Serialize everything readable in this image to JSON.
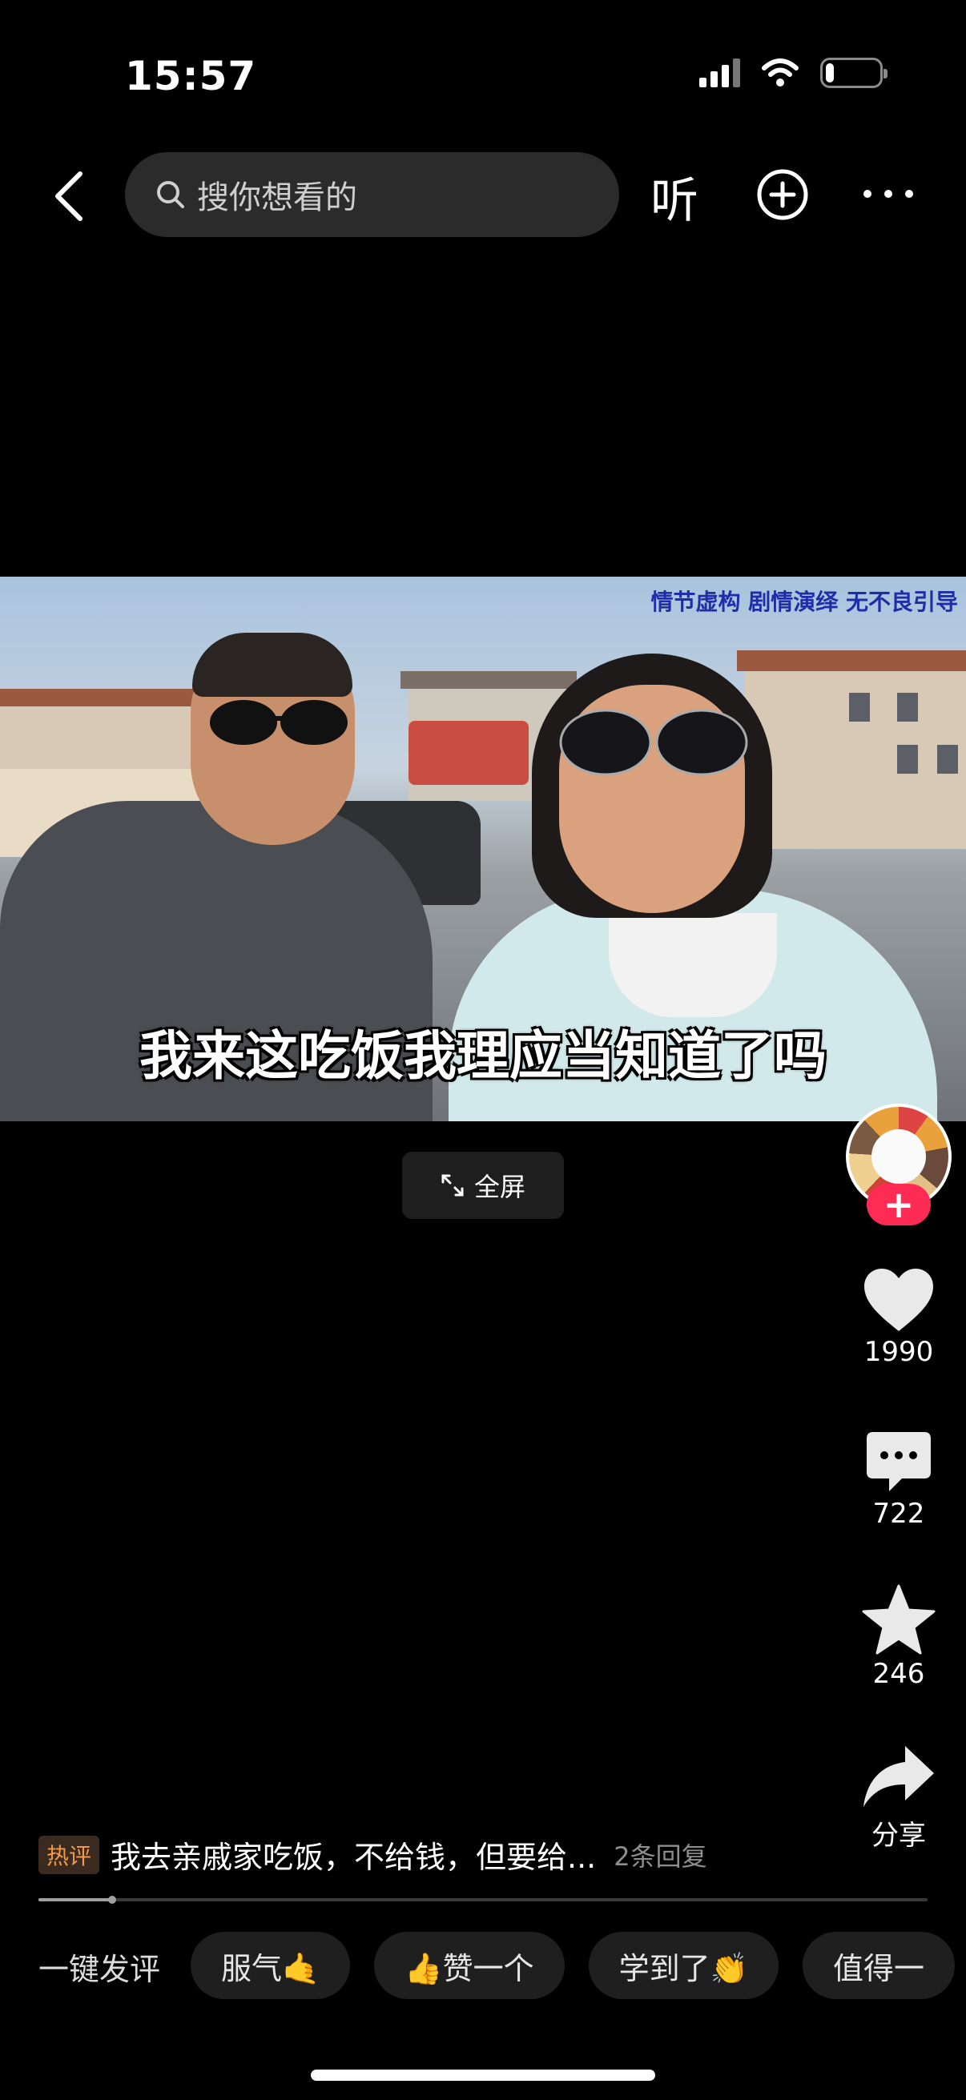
{
  "status_bar": {
    "time": "15:57",
    "battery_level": 0.15
  },
  "nav": {
    "search_placeholder": "搜你想看的",
    "listen_label": "听"
  },
  "video": {
    "disclaimer": "情节虚构 剧情演绎 无不良引导",
    "subtitle": "我来这吃饭我理应当知道了吗",
    "fullscreen_label": "全屏"
  },
  "rail": {
    "like_count": "1990",
    "comment_count": "722",
    "favorite_count": "246",
    "share_label": "分享",
    "follow_symbol": "+"
  },
  "hot_comment": {
    "badge": "热评",
    "text": "我去亲戚家吃饭，不给钱，但要给...",
    "replies": "2条回复"
  },
  "playback": {
    "progress": 0.083
  },
  "quick_reply": {
    "label": "一键发评",
    "chips": [
      "服气🤙",
      "👍赞一个",
      "学到了👏",
      "值得一"
    ]
  },
  "colors": {
    "accent": "#fe2c55",
    "badge_text": "#f2994a",
    "disclaimer": "#1f2ea8"
  }
}
